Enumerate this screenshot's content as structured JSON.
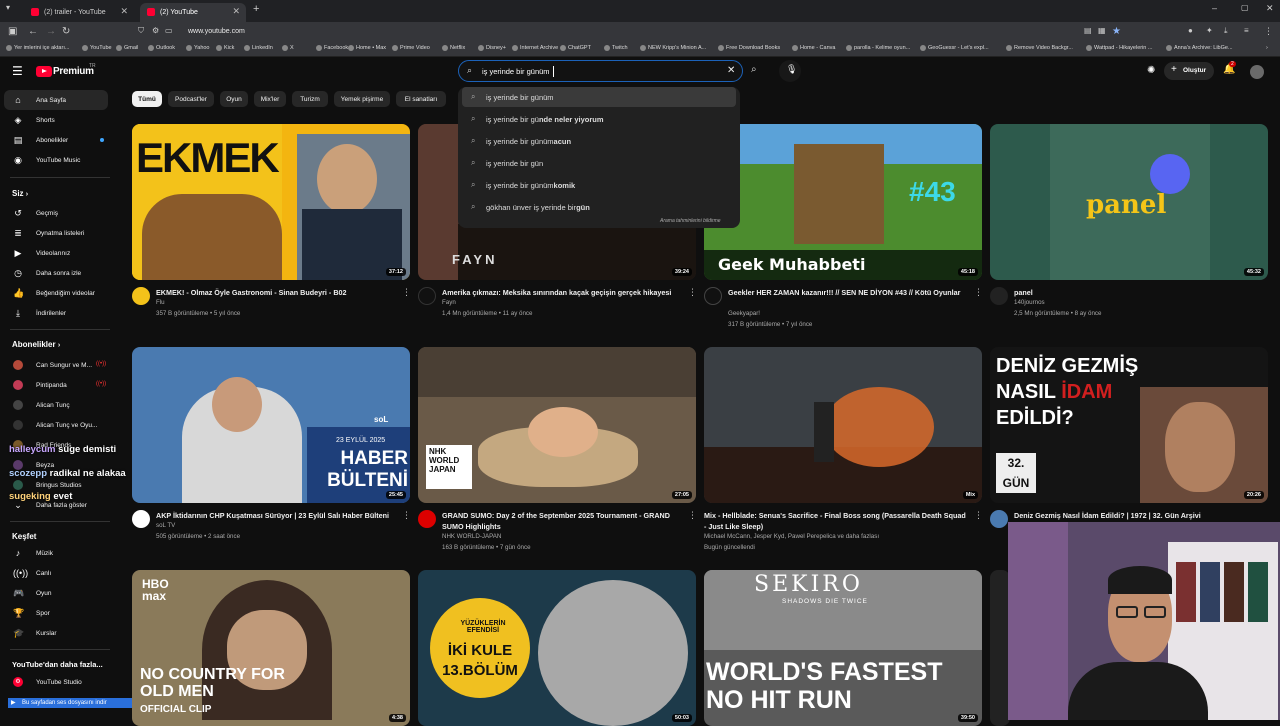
{
  "browser": {
    "tabs": [
      {
        "label": "(2) trailer - YouTube",
        "active": false
      },
      {
        "label": "(2) YouTube",
        "active": true
      }
    ],
    "url": "www.youtube.com",
    "bookmarks": [
      "Yer imlerini içe aktarı...",
      "YouTube",
      "Gmail",
      "Outlook",
      "Yahoo",
      "Kick",
      "LinkedIn",
      "X",
      "Facebook",
      "Home • Max",
      "Prime Video",
      "Netflix",
      "Disney+",
      "Internet Archive",
      "ChatGPT",
      "Twitch",
      "NEW Kripp's Minion A...",
      "Free Download Books",
      "Home - Canva",
      "parolla - Kelime oyun...",
      "GeoGuessr - Let's expl...",
      "Remove Video Backgr...",
      "Wattpad - Hikayelerin ...",
      "Anna's Archive: LibGe..."
    ]
  },
  "masthead": {
    "logo": "Premium",
    "logo_sup": "TR",
    "search_value": "iş yerinde bir günüm",
    "create_label": "Oluştur",
    "notif_count": "2"
  },
  "suggestions": {
    "items": [
      {
        "pre": "iş yerinde bir günüm",
        "bold": ""
      },
      {
        "pre": "iş yerinde bir gü",
        "bold": "nde neler yiyorum"
      },
      {
        "pre": "iş yerinde bir günüm",
        "bold": " acun"
      },
      {
        "pre": "iş yerinde bir gün",
        "bold": ""
      },
      {
        "pre": "iş yerinde bir günüm",
        "bold": " komik"
      },
      {
        "pre": "gökhan ünver iş yerinde bir",
        "bold": " gün"
      }
    ],
    "report": "Arama tahminlerini bildirme"
  },
  "sidebar": {
    "main": [
      "Ana Sayfa",
      "Shorts",
      "Abonelikler",
      "YouTube Music"
    ],
    "you_header": "Siz",
    "you": [
      "Geçmiş",
      "Oynatma listeleri",
      "Videolarınız",
      "Daha sonra izle",
      "Beğendiğim videolar",
      "İndirilenler"
    ],
    "subs_header": "Abonelikler",
    "subs": [
      "Can Sungur ve M...",
      "Pintipanda",
      "Alican Tunç",
      "Alican Tunç ve Oyu...",
      "Rad Friends",
      "Beyza",
      "Bringus Studios",
      "Daha fazla göster"
    ],
    "explore_header": "Keşfet",
    "explore": [
      "Müzik",
      "Canlı",
      "Oyun",
      "Spor",
      "Kurslar"
    ],
    "more_header": "YouTube'dan daha fazla...",
    "more": [
      "YouTube Studio"
    ],
    "download_bar": "Bu sayfadan ses dosyasını indir"
  },
  "chat_overlay": [
    {
      "user": "halleycum",
      "msg": "suge demisti"
    },
    {
      "user": "scozepp",
      "msg": "radikal ne alakaa"
    },
    {
      "user": "sugeking",
      "msg": "evet"
    }
  ],
  "chips": [
    "Tümü",
    "Podcast'ler",
    "Oyun",
    "Mix'ler",
    "Turizm",
    "Yemek pişirme",
    "El sanatları"
  ],
  "videos": [
    {
      "title": "EKMEK! - Olmaz Öyle Gastronomi - Sinan Budeyri - B02",
      "channel": "Flu",
      "meta": "357 B görüntüleme • 5 yıl önce",
      "duration": "37:12",
      "thumb_text": "EKMEK"
    },
    {
      "title": "Amerika çıkmazı: Meksika sınırından kaçak geçişin gerçek hikayesi",
      "channel": "Fayn",
      "meta": "1,4 Mn görüntüleme • 11 ay önce",
      "duration": "39:24",
      "thumb_text": "FAYN"
    },
    {
      "title": "Geekler HER ZAMAN kazanır!!! // SEN NE DİYON #43 // Kötü Oyunlar",
      "channel": "Geekyapar!",
      "meta": "317 B görüntüleme • 7 yıl önce",
      "duration": "45:18",
      "thumb_text": "Geek Muhabbeti"
    },
    {
      "title": "panel",
      "channel": "140journos",
      "meta": "2,5 Mn görüntüleme • 8 ay önce",
      "duration": "45:32",
      "thumb_text": "panel"
    },
    {
      "title": "AKP İktidarının CHP Kuşatması Sürüyor | 23 Eylül Salı Haber Bülteni",
      "channel": "soL TV",
      "meta": "505 görüntüleme • 2 saat önce",
      "duration": "25:45",
      "thumb_text": "HABER BÜLTENİ"
    },
    {
      "title": "GRAND SUMO: Day 2 of the September 2025 Tournament - GRAND SUMO Highlights",
      "channel": "NHK WORLD-JAPAN",
      "meta": "163 B görüntüleme • 7 gün önce",
      "duration": "27:05",
      "thumb_text": "NHK WORLD JAPAN"
    },
    {
      "title": "Mix - Hellblade: Senua's Sacrifice - Final Boss song (Passarella Death Squad - Just Like Sleep)",
      "channel": "Michael McCann, Jesper Kyd, Pawel Perepelica ve daha fazlası",
      "meta": "Bugün güncellendi",
      "duration": "Mix",
      "thumb_text": ""
    },
    {
      "title": "Deniz Gezmiş Nasıl İdam Edildi? | 1972 | 32. Gün Arşivi",
      "channel": "",
      "meta": "",
      "duration": "20:26",
      "thumb_text": "DENİZ GEZMİŞ"
    },
    {
      "title": "",
      "channel": "",
      "meta": "",
      "duration": "4:38",
      "thumb_text": "NO COUNTRY FOR OLD MEN"
    },
    {
      "title": "",
      "channel": "",
      "meta": "",
      "duration": "50:03",
      "thumb_text": "İKİ KULE"
    },
    {
      "title": "",
      "channel": "",
      "meta": "",
      "duration": "39:50",
      "thumb_text": "WORLD'S FASTEST"
    }
  ]
}
